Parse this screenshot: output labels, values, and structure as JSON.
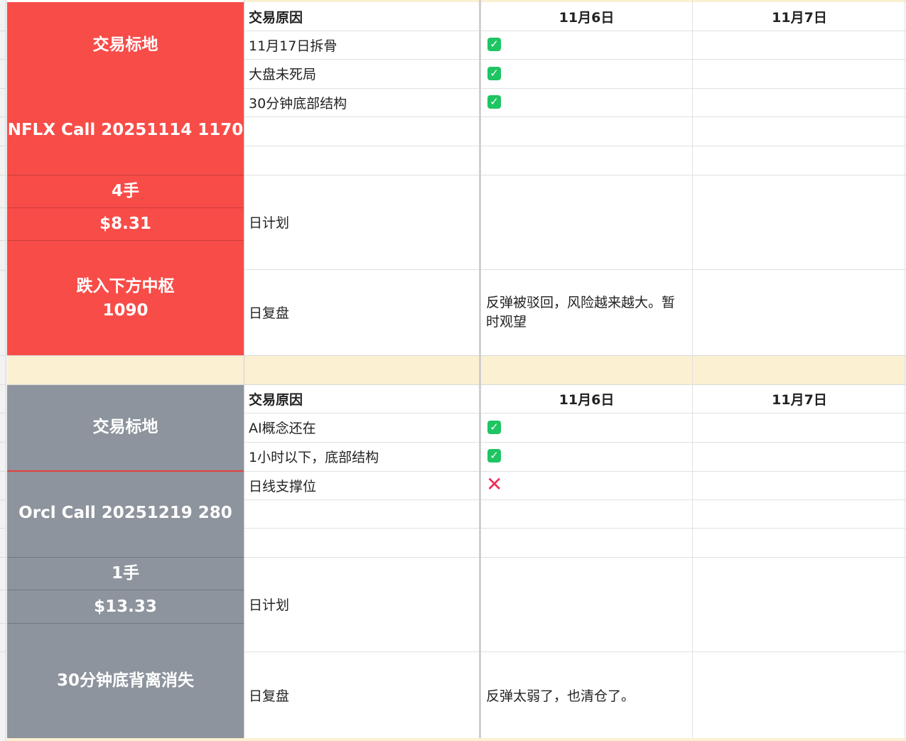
{
  "colors": {
    "red_block": "#f84c48",
    "gray_block": "#8d949d",
    "separator": "#fbf0d2",
    "check_green": "#1ec562",
    "cross_red": "#ee2f56"
  },
  "icons": {
    "check": "check-box-icon",
    "cross": "cross-icon"
  },
  "blocks": [
    {
      "target_label": "交易标地",
      "symbol": "NFLX Call 20251114 1170",
      "quantity": "4手",
      "price": "$8.31",
      "stop_line1": "跌入下方中枢",
      "stop_line2": "1090",
      "header": "交易原因",
      "date1": "11月6日",
      "date2": "11月7日",
      "reasons": [
        "11月17日拆骨",
        "大盘未死局",
        "30分钟底部结构"
      ],
      "checks": [
        "✓",
        "✓",
        "✓"
      ],
      "plan_label": "日计划",
      "review_label": "日复盘",
      "review_note_d1": "反弹被驳回，风险越来越大。暂时观望"
    },
    {
      "target_label": "交易标地",
      "symbol": "Orcl Call 20251219 280",
      "quantity": "1手",
      "price": "$13.33",
      "stop_line1": "30分钟底背离消失",
      "header": "交易原因",
      "date1": "11月6日",
      "date2": "11月7日",
      "reasons": [
        "AI概念还在",
        "1小时以下，底部结构",
        "日线支撑位"
      ],
      "checks": [
        "✓",
        "✓",
        "✕"
      ],
      "plan_label": "日计划",
      "review_label": "日复盘",
      "review_note_d1": "反弹太弱了，也清仓了。"
    }
  ]
}
